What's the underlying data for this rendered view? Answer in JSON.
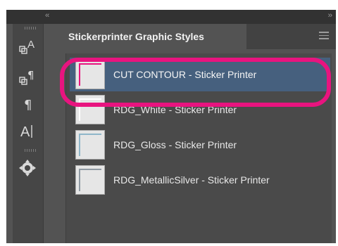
{
  "topbar": {
    "collapse_left_glyph": "‹‹",
    "collapse_right_glyph": "››"
  },
  "tools": [
    {
      "name": "character-styles-icon"
    },
    {
      "name": "paragraph-styles-icon"
    },
    {
      "name": "paragraph-icon"
    },
    {
      "name": "character-icon"
    },
    {
      "name": "graphic-styles-icon"
    }
  ],
  "panel": {
    "tab_title": "Stickerprinter Graphic Styles",
    "menu_icon": "hamburger-menu-icon"
  },
  "styles": [
    {
      "label": "CUT CONTOUR - Sticker Printer",
      "selected": true,
      "stroke_color": "#e8147f"
    },
    {
      "label": "RDG_White - Sticker Printer",
      "selected": false,
      "stroke_color": "#f0f0f0"
    },
    {
      "label": "RDG_Gloss - Sticker Printer",
      "selected": false,
      "stroke_color": "#8fb6c9"
    },
    {
      "label": "RDG_MetallicSilver - Sticker Printer",
      "selected": false,
      "stroke_color": "#8f9aa3"
    }
  ],
  "colors": {
    "selection": "#46607e",
    "annotation_highlight": "#e8147f"
  }
}
